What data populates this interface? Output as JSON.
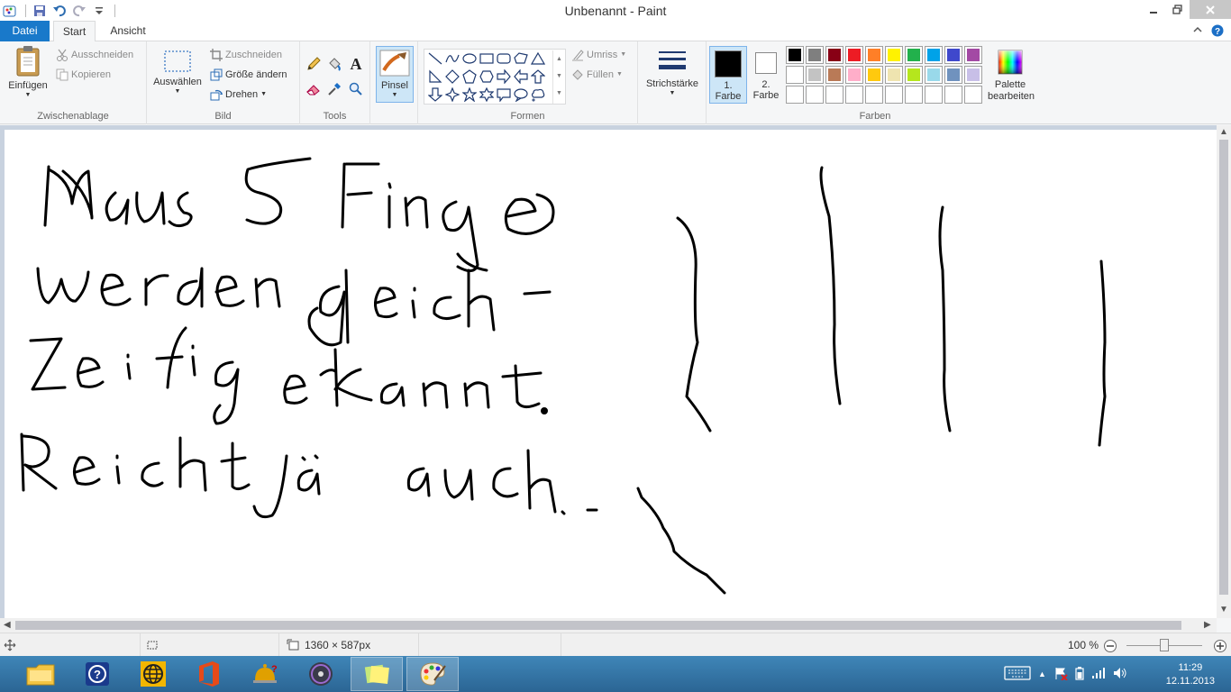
{
  "window": {
    "title": "Unbenannt - Paint"
  },
  "tabs": {
    "file": "Datei",
    "start": "Start",
    "view": "Ansicht"
  },
  "clipboard": {
    "paste": "Einfügen",
    "cut": "Ausschneiden",
    "copy": "Kopieren",
    "label": "Zwischenablage"
  },
  "image": {
    "select": "Auswählen",
    "crop": "Zuschneiden",
    "resize": "Größe ändern",
    "rotate": "Drehen",
    "label": "Bild"
  },
  "tools": {
    "label": "Tools"
  },
  "brush": {
    "label": "Pinsel"
  },
  "shapes": {
    "outline": "Umriss",
    "fill": "Füllen",
    "label": "Formen"
  },
  "size": {
    "label": "Strichstärke"
  },
  "colors": {
    "color1": "1. Farbe",
    "color2": "2. Farbe",
    "edit": "Palette bearbeiten",
    "label": "Farben",
    "row1": [
      "#000000",
      "#7f7f7f",
      "#880015",
      "#ed1c24",
      "#ff7f27",
      "#fff200",
      "#22b14c",
      "#00a2e8",
      "#3f48cc",
      "#a349a4"
    ],
    "row2": [
      "#ffffff",
      "#c3c3c3",
      "#b97a57",
      "#ffaec9",
      "#ffc90e",
      "#efe4b0",
      "#b5e61d",
      "#99d9ea",
      "#7092be",
      "#c8bfe7"
    ]
  },
  "status": {
    "dimensions": "1360 × 587px",
    "zoom": "100 %"
  },
  "clock": {
    "time": "11:29",
    "date": "12.11.2013"
  }
}
